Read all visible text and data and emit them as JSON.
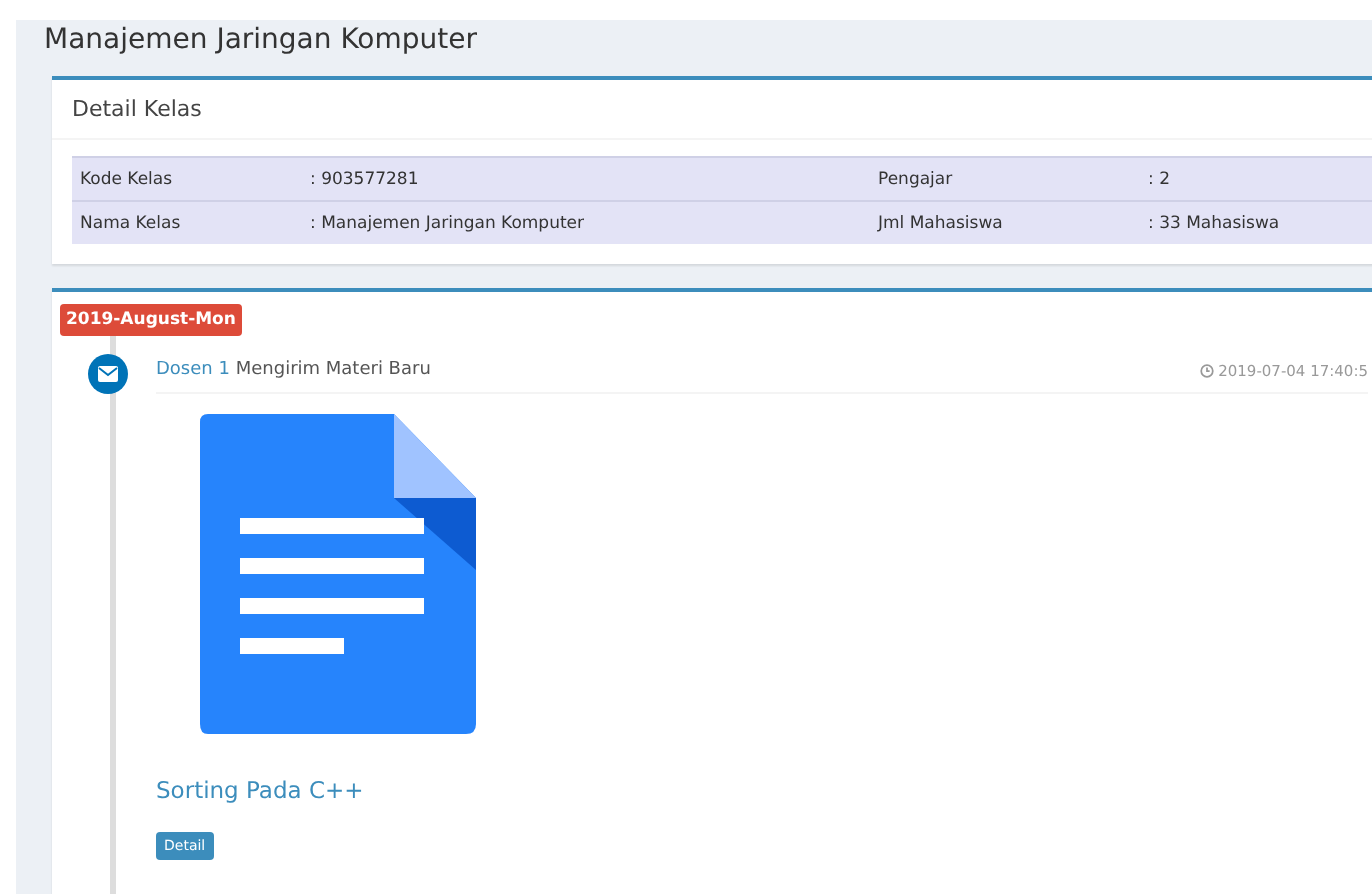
{
  "page_title": "Manajemen Jaringan Komputer",
  "detail_box": {
    "title": "Detail Kelas",
    "rows": [
      {
        "label_1": "Kode Kelas",
        "value_1": ": 903577281",
        "label_2": "Pengajar",
        "value_2": ": 2"
      },
      {
        "label_1": "Nama Kelas",
        "value_1": ": Manajemen Jaringan Komputer",
        "label_2": "Jml Mahasiswa",
        "value_2": ": 33 Mahasiswa"
      }
    ]
  },
  "timeline": {
    "date_label": "2019-August-Mon",
    "items": [
      {
        "sender": "Dosen 1",
        "action": "Mengirim Materi Baru",
        "time": "2019-07-04 17:40:5",
        "kind": "document",
        "file_title": "Sorting Pada C++",
        "button": "Detail"
      }
    ]
  }
}
